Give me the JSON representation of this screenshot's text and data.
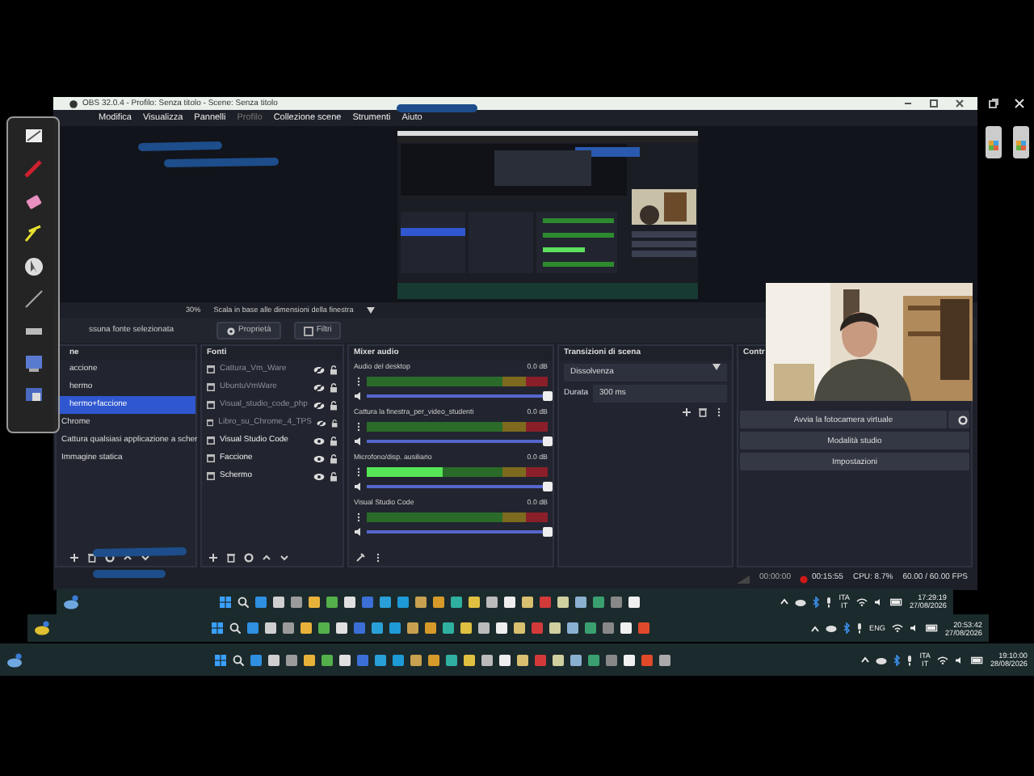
{
  "window": {
    "title": "OBS 32.0.4 - Profilo: Senza titolo - Scene: Senza titolo"
  },
  "menu": [
    {
      "label": "Modifica",
      "disabled": false
    },
    {
      "label": "Visualizza",
      "disabled": false
    },
    {
      "label": "Pannelli",
      "disabled": false
    },
    {
      "label": "Profilo",
      "disabled": true
    },
    {
      "label": "Collezione scene",
      "disabled": false
    },
    {
      "label": "Strumenti",
      "disabled": false
    },
    {
      "label": "Aiuto",
      "disabled": false
    }
  ],
  "preview": {
    "zoom": "30%",
    "scale": "Scala in base alle dimensioni della finestra"
  },
  "source_bar": {
    "label": "ssuna fonte selezionata",
    "buttons": [
      {
        "label": "Proprietà",
        "kind": "gear"
      },
      {
        "label": "Filtri",
        "kind": "filter"
      }
    ]
  },
  "scenes": {
    "title": "ne",
    "items": [
      {
        "label": "accione",
        "selected": false
      },
      {
        "label": "hermo",
        "selected": false
      },
      {
        "label": "hermo+faccione",
        "selected": true
      },
      {
        "label": "Chrome",
        "selected": false
      },
      {
        "label": "Cattura qualsiasi applicazione a scher",
        "selected": false
      },
      {
        "label": "Immagine statica",
        "selected": false
      }
    ]
  },
  "sources": {
    "title": "Fonti",
    "items": [
      {
        "label": "Cattura_Vm_Ware",
        "visible": false
      },
      {
        "label": "UbuntuVmWare",
        "visible": false
      },
      {
        "label": "Visual_studio_code_php",
        "visible": false
      },
      {
        "label": "Libro_su_Chrome_4_TPS",
        "visible": false
      },
      {
        "label": "Visual Studio Code",
        "visible": true
      },
      {
        "label": "Faccione",
        "visible": true
      },
      {
        "label": "Schermo",
        "visible": true
      }
    ]
  },
  "mixer": {
    "title": "Mixer audio",
    "channels": [
      {
        "name": "Audio del desktop",
        "reading": "0.0 dB",
        "level": 0,
        "volume": {
          "level": 1
        }
      },
      {
        "name": "Cattura la finestra_per_video_studenti",
        "reading": "0.0 dB",
        "level": 0,
        "volume": {
          "level": 1
        }
      },
      {
        "name": "Microfono/disp. ausiliario",
        "reading": "0.0 dB",
        "level": 0.42,
        "volume": {
          "level": 1
        }
      },
      {
        "name": "Visual Studio Code",
        "reading": "0.0 dB",
        "level": 0,
        "volume": {
          "level": 1
        }
      }
    ]
  },
  "transitions": {
    "title": "Transizioni di scena",
    "type": "Dissolvenza",
    "duration_label": "Durata",
    "duration": "300 ms"
  },
  "controls": {
    "title": "Contr",
    "buttons": [
      "Avvia la fotocamera virtuale",
      "Modalità studio",
      "Impostazioni"
    ]
  },
  "status_bar": {
    "stream_time": "00:00:00",
    "record_time": "00:15:55",
    "recording": true,
    "cpu": "CPU: 8.7%",
    "fps": "60.00 / 60.00 FPS"
  },
  "taskbars": [
    {
      "language": [
        "ITA",
        "IT"
      ],
      "time": "17:29:19",
      "date": "27/08/2026"
    },
    {
      "language": [
        "ENG"
      ],
      "time": "20:53:42",
      "date": "27/08/2026"
    },
    {
      "language": [
        "ITA",
        "IT"
      ],
      "time": "19:10:00",
      "date": "28/08/2026"
    }
  ]
}
